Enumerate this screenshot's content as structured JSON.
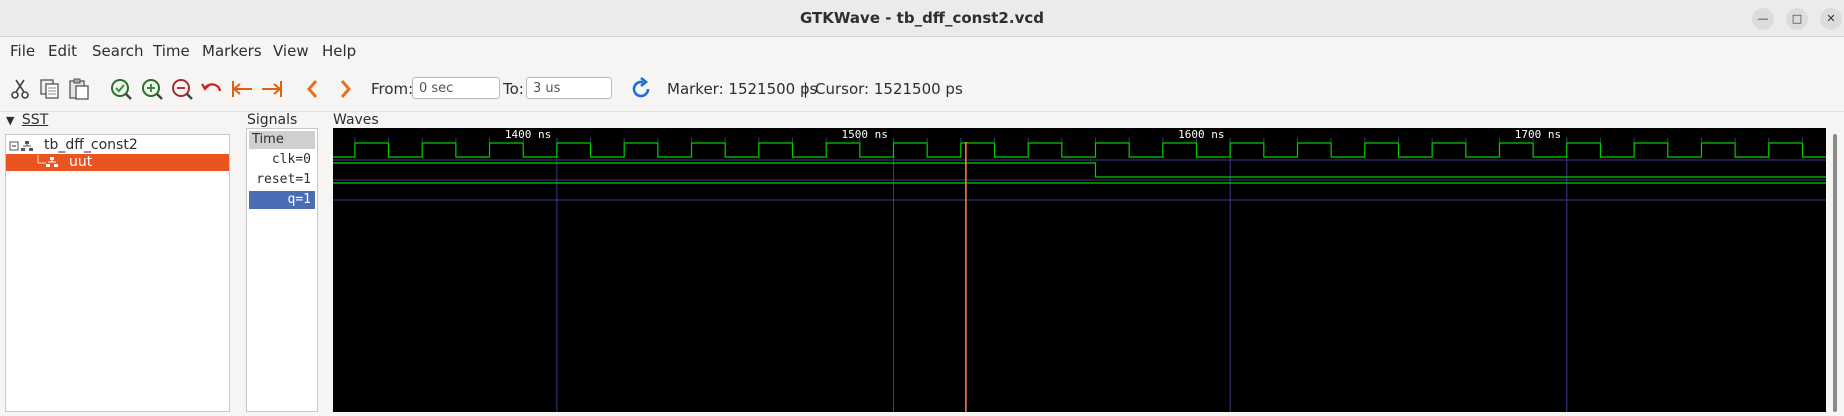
{
  "window": {
    "title": "GTKWave - tb_dff_const2.vcd"
  },
  "menu": [
    "File",
    "Edit",
    "Search",
    "Time",
    "Markers",
    "View",
    "Help"
  ],
  "toolbar": {
    "from_label": "From:",
    "from_value": "0 sec",
    "to_label": "To:",
    "to_value": "3 us",
    "marker_text": "Marker: 1521500 ps",
    "separator": "|",
    "cursor_text": "Cursor: 1521500 ps"
  },
  "sst": {
    "header": "SST",
    "tree": [
      {
        "label": "tb_dff_const2",
        "selected": false
      },
      {
        "label": "uut",
        "selected": true
      }
    ]
  },
  "signals": {
    "header": "Signals",
    "time_label": "Time",
    "rows": [
      {
        "name": "clk",
        "value": "0"
      },
      {
        "name": "reset",
        "value": "1"
      },
      {
        "name": "q",
        "value": "1"
      }
    ]
  },
  "waves": {
    "header": "Waves",
    "time_start_ns": 1333.5,
    "time_end_ns": 1777,
    "ticks_ns": [
      1400,
      1500,
      1600,
      1700
    ],
    "tick_labels": [
      "1400 ns",
      "1500 ns",
      "1600 ns",
      "1700 ns"
    ],
    "clk_period_ns": 20,
    "clk_first_rise_ns": 1340,
    "reset_fall_ns": 1560,
    "marker_ns": 1521.5,
    "colors": {
      "trace": "#00d000",
      "grid": "#3a3a8a",
      "marker": "#ff8040",
      "ticktext": "#ffffff"
    }
  }
}
